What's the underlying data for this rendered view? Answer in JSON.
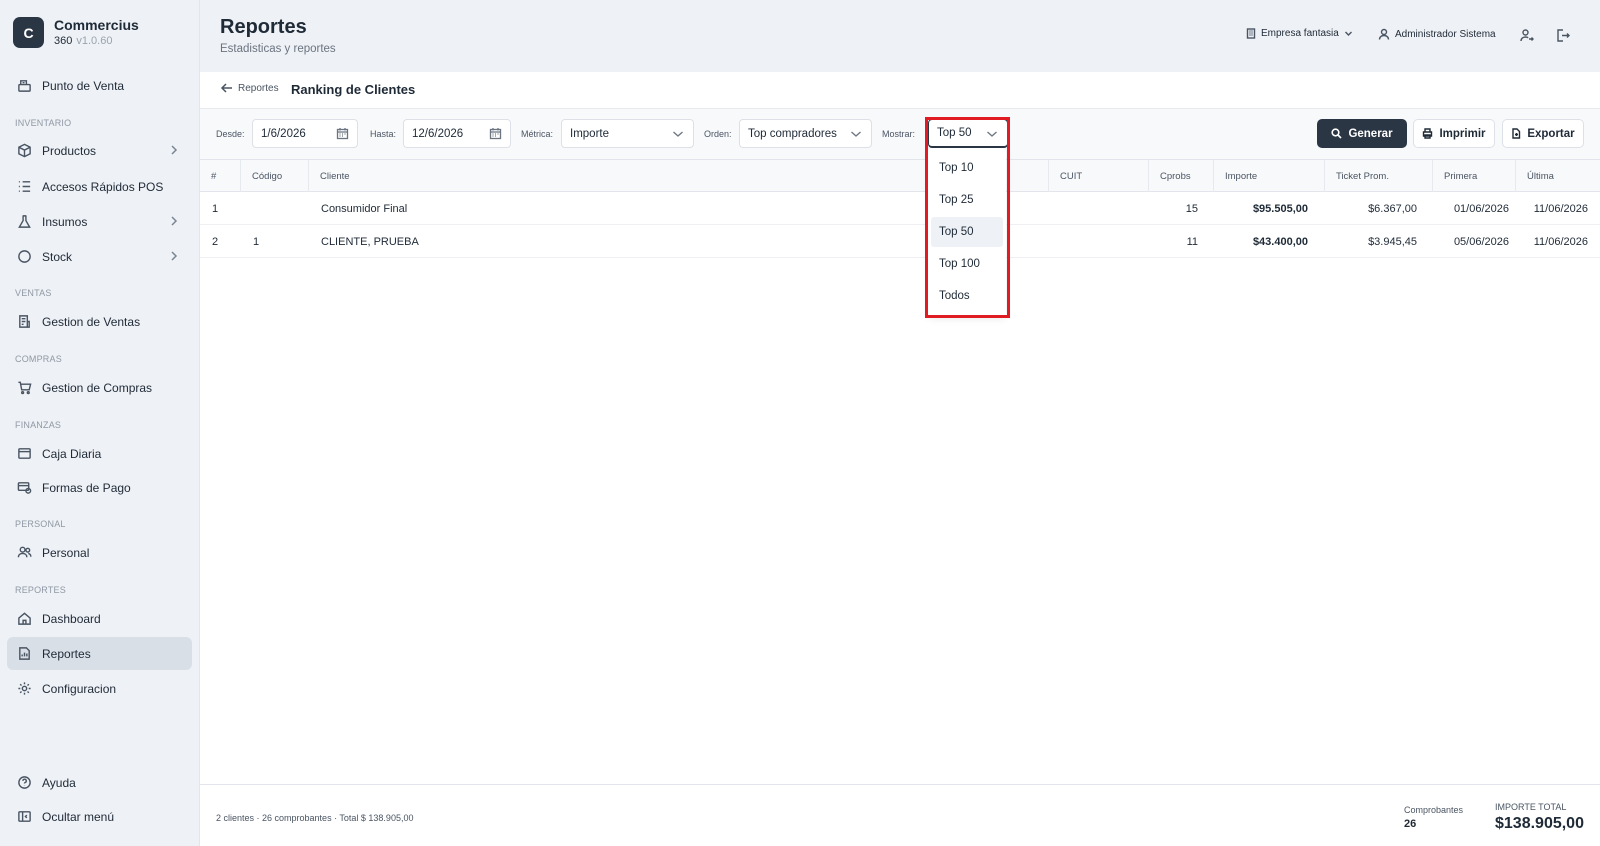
{
  "app": {
    "logo_letter": "C",
    "name": "Commercius",
    "sub": "360",
    "version": "v1.0.60"
  },
  "sidebar": {
    "pos": "Punto de Venta",
    "sections": {
      "inventario": "INVENTARIO",
      "ventas": "VENTAS",
      "compras": "COMPRAS",
      "finanzas": "FINANZAS",
      "personal": "PERSONAL",
      "reportes": "REPORTES"
    },
    "items": {
      "productos": "Productos",
      "accesos": "Accesos Rápidos POS",
      "insumos": "Insumos",
      "stock": "Stock",
      "gestion_ventas": "Gestion de Ventas",
      "gestion_compras": "Gestion de Compras",
      "caja": "Caja Diaria",
      "formas_pago": "Formas de Pago",
      "personal": "Personal",
      "dashboard": "Dashboard",
      "reportes": "Reportes",
      "configuracion": "Configuracion",
      "ayuda": "Ayuda",
      "ocultar": "Ocultar menú"
    }
  },
  "header": {
    "title": "Reportes",
    "subtitle": "Estadisticas y reportes",
    "company": "Empresa fantasia",
    "user": "Administrador Sistema"
  },
  "breadcrumb": {
    "back": "Reportes",
    "title": "Ranking de Clientes"
  },
  "filters": {
    "desde_label": "Desde:",
    "desde_value": "1/6/2026",
    "hasta_label": "Hasta:",
    "hasta_value": "12/6/2026",
    "metrica_label": "Métrica:",
    "metrica_value": "Importe",
    "orden_label": "Orden:",
    "orden_value": "Top compradores",
    "mostrar_label": "Mostrar:",
    "mostrar_value": "Top 50",
    "mostrar_options": [
      "Top 10",
      "Top 25",
      "Top 50",
      "Top 100",
      "Todos"
    ]
  },
  "actions": {
    "generar": "Generar",
    "imprimir": "Imprimir",
    "exportar": "Exportar"
  },
  "table": {
    "headers": [
      "#",
      "Código",
      "Cliente",
      "CUIT",
      "Cprobs",
      "Importe",
      "Ticket Prom.",
      "Primera",
      "Última"
    ],
    "rows": [
      {
        "n": "1",
        "codigo": "",
        "cliente": "Consumidor Final",
        "cuit": "",
        "cprobs": "15",
        "importe": "$95.505,00",
        "ticket": "$6.367,00",
        "primera": "01/06/2026",
        "ultima": "11/06/2026"
      },
      {
        "n": "2",
        "codigo": "1",
        "cliente": "CLIENTE, PRUEBA",
        "cuit": "",
        "cprobs": "11",
        "importe": "$43.400,00",
        "ticket": "$3.945,45",
        "primera": "05/06/2026",
        "ultima": "11/06/2026"
      }
    ]
  },
  "footer": {
    "summary": "2 clientes · 26 comprobantes · Total $ 138.905,00",
    "comprobantes_label": "Comprobantes",
    "comprobantes_value": "26",
    "importe_label": "IMPORTE TOTAL",
    "importe_value": "$138.905,00"
  },
  "colors": {
    "primary": "#2b3645",
    "highlight": "#e01b24",
    "sidebar_bg": "#eef1f5"
  }
}
